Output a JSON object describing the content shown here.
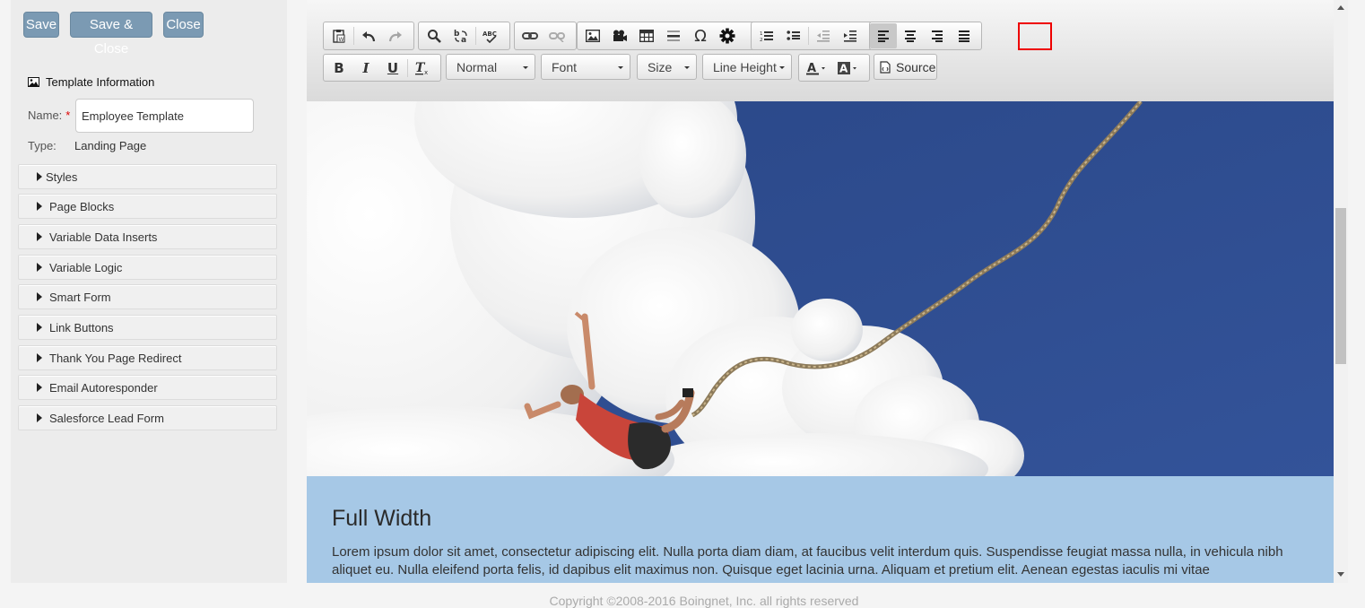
{
  "actions": {
    "save": "Save",
    "save_close": "Save & Close",
    "close": "Close"
  },
  "template_info": {
    "header": "Template Information",
    "name_label": "Name:",
    "required_mark": "*",
    "name_value": "Employee Template",
    "type_label": "Type:",
    "type_value": "Landing Page"
  },
  "sections": [
    "Styles",
    "Page Blocks",
    "Variable Data Inserts",
    "Variable Logic",
    "Smart Form",
    "Link Buttons",
    "Thank You Page Redirect",
    "Email Autoresponder",
    "Salesforce Lead Form"
  ],
  "toolbar": {
    "format_select": "Normal",
    "font_select": "Font",
    "size_select": "Size",
    "line_height_select": "Line Height",
    "source_label": "Source",
    "bold": "B",
    "italic": "I",
    "underline": "U",
    "special_char": "Ω",
    "highlighted_button": "gear-icon",
    "highlight_color": "#e00000"
  },
  "content": {
    "title": "Full Width",
    "body": "Lorem ipsum dolor sit amet, consectetur adipiscing elit. Nulla porta diam diam, at faucibus velit interdum quis. Suspendisse feugiat massa nulla, in vehicula nibh aliquet eu. Nulla eleifend porta felis, id dapibus elit maximus non. Quisque eget lacinia urna. Aliquam et pretium elit. Aenean egestas iaculis mi vitae",
    "background": "#a6c8e6"
  },
  "footer": {
    "copyright": "Copyright ©2008-2016 Boingnet, Inc. all rights reserved"
  },
  "colors": {
    "button": "#7b9ab3",
    "sky": "#2c4b8c"
  }
}
